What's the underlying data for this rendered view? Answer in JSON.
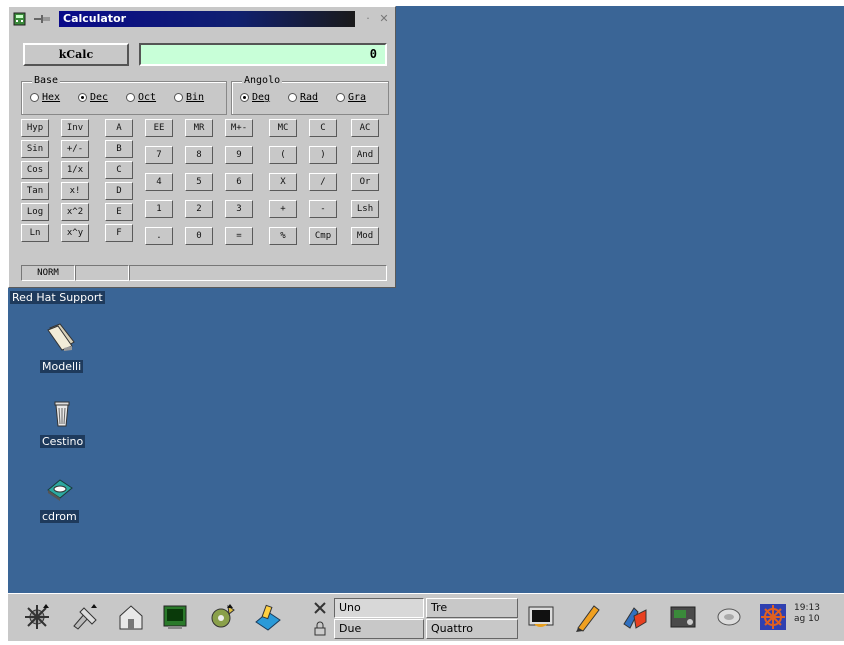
{
  "desktop": {
    "bg_color": "#3a6596",
    "icons": [
      {
        "label": "Red Hat Support",
        "icon": "support-icon"
      },
      {
        "label": "Modelli",
        "icon": "folder-icon"
      },
      {
        "label": "Cestino",
        "icon": "trash-icon"
      },
      {
        "label": "cdrom",
        "icon": "cdrom-icon"
      }
    ]
  },
  "calculator": {
    "title": "Calculator",
    "kcalc_label": "kCalc",
    "display_value": "0",
    "base": {
      "title": "Base",
      "options": [
        {
          "label": "Hex",
          "checked": false
        },
        {
          "label": "Dec",
          "checked": true
        },
        {
          "label": "Oct",
          "checked": false
        },
        {
          "label": "Bin",
          "checked": false
        }
      ]
    },
    "angle": {
      "title": "Angolo",
      "options": [
        {
          "label": "Deg",
          "checked": true
        },
        {
          "label": "Rad",
          "checked": false
        },
        {
          "label": "Gra",
          "checked": false
        }
      ]
    },
    "keys": [
      [
        "Hyp",
        "Inv",
        "A",
        "EE",
        "MR",
        "M+-",
        "MC",
        "C",
        "AC"
      ],
      [
        "Sin",
        "+/-",
        "B",
        "7",
        "8",
        "9",
        "(",
        ")",
        "And"
      ],
      [
        "Cos",
        "1/x",
        "C",
        "4",
        "5",
        "6",
        "X",
        "/",
        "Or"
      ],
      [
        "Tan",
        "x!",
        "D",
        "1",
        "2",
        "3",
        "+",
        "-",
        "Lsh"
      ],
      [
        "Log",
        "x^2",
        "E",
        ".",
        "0",
        "=",
        "%",
        "Cmp",
        "Mod"
      ],
      [
        "Ln",
        "x^y",
        "F"
      ]
    ],
    "status": {
      "mode": "NORM",
      "cell2": "",
      "cell3": ""
    }
  },
  "taskbar": {
    "desktops": [
      "Uno",
      "Tre",
      "Due",
      "Quattro"
    ],
    "active_desktop": "Uno",
    "clock_time": "19:13",
    "clock_date": "ag 10"
  }
}
